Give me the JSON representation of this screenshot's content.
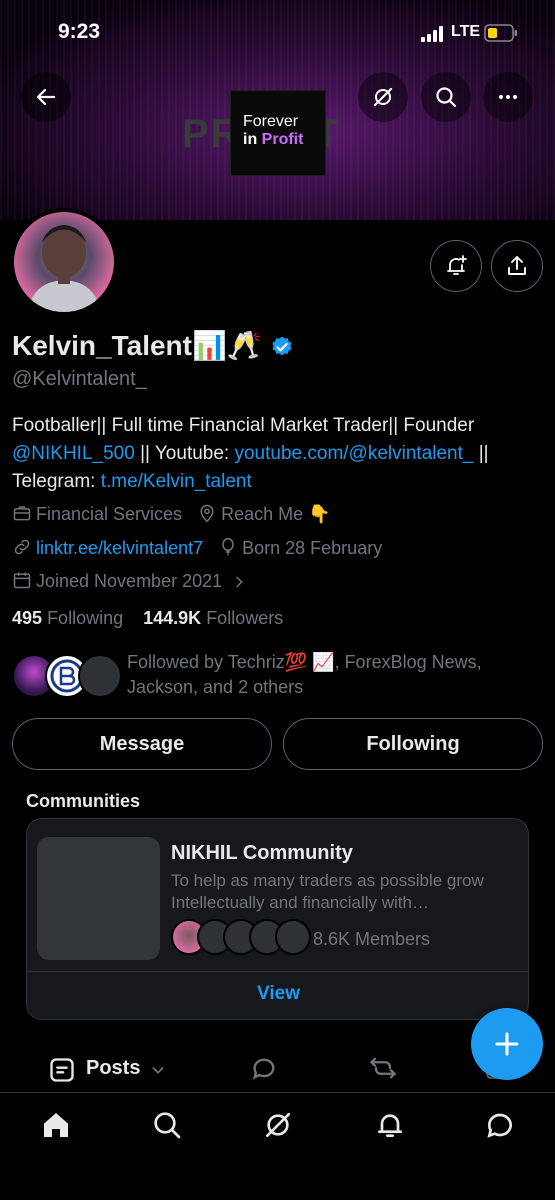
{
  "status_bar": {
    "time": "9:23",
    "network": "LTE"
  },
  "banner": {
    "big_word": "PROFIT",
    "card_line1": "Forever",
    "card_line2a": "in ",
    "card_line2b": "Profit"
  },
  "profile": {
    "name": "Kelvin_Talent📊🥂",
    "handle": "@Kelvintalent_",
    "bio_text1": "Footballer|| Full time Financial Market Trader|| Founder ",
    "bio_mention": "@NIKHIL_500",
    "bio_text2": " || Youtube: ",
    "bio_youtube": "youtube.com/@kelvintalent_",
    "bio_text3": " || Telegram: ",
    "bio_telegram": "t.me/Kelvin_talent",
    "category": "Financial Services",
    "location": "Reach Me 👇",
    "website": "linktr.ee/kelvintalent7",
    "birthday": "Born 28 February",
    "joined": "Joined November 2021",
    "following_count": "495",
    "following_label": "Following",
    "followers_count": "144.9K",
    "followers_label": "Followers",
    "followed_by": "Followed by Techriz💯 📈, ForexBlog News, Jackson, and 2 others"
  },
  "actions": {
    "message": "Message",
    "following": "Following"
  },
  "communities": {
    "heading": "Communities",
    "name": "NIKHIL Community",
    "description": "To help as many traders as possible grow Intellectually and financially with…",
    "members": "8.6K Members",
    "view": "View"
  },
  "tabs": {
    "posts": "Posts"
  },
  "colors": {
    "accent": "#1d9bf0",
    "text": "#e7e9ea",
    "muted": "#71767b",
    "border": "#2f3336"
  }
}
